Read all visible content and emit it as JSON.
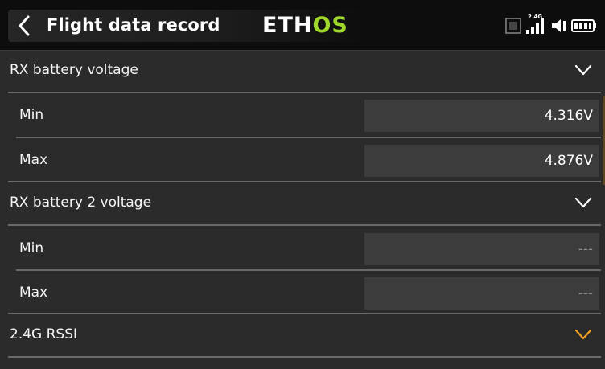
{
  "header": {
    "title": "Flight data record",
    "logo_part1": "ETH",
    "logo_part2": "OS",
    "band_label": "2.4G"
  },
  "colors": {
    "accent_orange": "#f0a020",
    "logo_green": "#9fd72a",
    "chevron_white": "#ffffff"
  },
  "sections": [
    {
      "label": "RX battery voltage",
      "icon": "chevron-down-icon",
      "fields": [
        {
          "label": "Min",
          "value": "4.316V"
        },
        {
          "label": "Max",
          "value": "4.876V"
        }
      ]
    },
    {
      "label": "RX battery 2 voltage",
      "icon": "chevron-down-icon",
      "fields": [
        {
          "label": "Min",
          "value": "---"
        },
        {
          "label": "Max",
          "value": "---"
        }
      ]
    },
    {
      "label": "2.4G RSSI",
      "icon": "chevron-down-icon"
    }
  ]
}
